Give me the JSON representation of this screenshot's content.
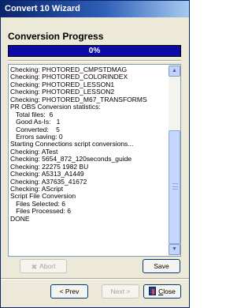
{
  "window": {
    "title": "Convert 10 Wizard"
  },
  "heading": "Conversion Progress",
  "progress": {
    "percent": 0,
    "label": "0%"
  },
  "log": {
    "lines": [
      "Checking: PHOTORED_CMPSTDMAG",
      "Checking: PHOTORED_COLORINDEX",
      "Checking: PHOTORED_LESSON1",
      "Checking: PHOTORED_LESSON2",
      "Checking: PHOTORED_M67_TRANSFORMS",
      "PR OBS Conversion statistics:",
      "   Total files:  6",
      "   Good As-Is:   1",
      "   Converted:    5",
      "   Errors saving: 0",
      "Starting Connections script conversions...",
      "Checking: ATest",
      "Checking: 5654_872_120seconds_guide",
      "Checking: 22275 1982 BU",
      "Checking: A5313_A1449",
      "Checking: A37635_41672",
      "Checking: AScript",
      "Script File Conversion",
      "   Files Selected: 6",
      "   Files Processed: 6",
      "DONE"
    ]
  },
  "buttons": {
    "abort": "Abort",
    "save": "Save",
    "prev": "< Prev",
    "next": "Next >",
    "close_first": "C",
    "close_rest": "lose"
  },
  "icons": {
    "abort": "abort-icon",
    "close": "close-door-icon",
    "scroll_up": "scroll-up-arrow-icon",
    "scroll_down": "scroll-down-arrow-icon"
  },
  "colors": {
    "title_bar": "#0a246a",
    "progress_fill": "#0a0aa8",
    "window_bg": "#ece9d8"
  }
}
